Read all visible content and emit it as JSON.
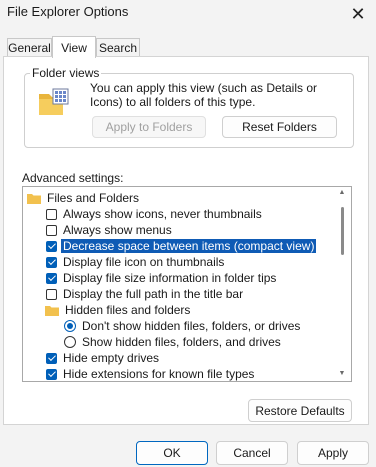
{
  "window": {
    "title": "File Explorer Options",
    "close_glyph": "✕"
  },
  "tabs": [
    {
      "label": "General",
      "active": false
    },
    {
      "label": "View",
      "active": true
    },
    {
      "label": "Search",
      "active": false
    }
  ],
  "folder_views": {
    "legend": "Folder views",
    "description": "You can apply this view (such as Details or Icons) to all folders of this type.",
    "apply_button": "Apply to Folders",
    "reset_button": "Reset Folders",
    "icon": "folder-grid-icon"
  },
  "advanced": {
    "label": "Advanced settings:",
    "items": [
      {
        "type": "folder",
        "label": "Files and Folders",
        "indent": 0
      },
      {
        "type": "checkbox",
        "label": "Always show icons, never thumbnails",
        "checked": false,
        "indent": 1
      },
      {
        "type": "checkbox",
        "label": "Always show menus",
        "checked": false,
        "indent": 1
      },
      {
        "type": "checkbox",
        "label": "Decrease space between items (compact view)",
        "checked": true,
        "indent": 1,
        "selected": true
      },
      {
        "type": "checkbox",
        "label": "Display file icon on thumbnails",
        "checked": true,
        "indent": 1
      },
      {
        "type": "checkbox",
        "label": "Display file size information in folder tips",
        "checked": true,
        "indent": 1
      },
      {
        "type": "checkbox",
        "label": "Display the full path in the title bar",
        "checked": false,
        "indent": 1
      },
      {
        "type": "folder",
        "label": "Hidden files and folders",
        "indent": 1
      },
      {
        "type": "radio",
        "label": "Don't show hidden files, folders, or drives",
        "checked": true,
        "indent": 2
      },
      {
        "type": "radio",
        "label": "Show hidden files, folders, and drives",
        "checked": false,
        "indent": 2
      },
      {
        "type": "checkbox",
        "label": "Hide empty drives",
        "checked": true,
        "indent": 1
      },
      {
        "type": "checkbox",
        "label": "Hide extensions for known file types",
        "checked": true,
        "indent": 1
      }
    ]
  },
  "restore_defaults": "Restore Defaults",
  "footer": {
    "ok": "OK",
    "cancel": "Cancel",
    "apply": "Apply"
  },
  "colors": {
    "accent": "#005fb8",
    "selection": "#0f5bb5",
    "folder": "#f2c14e"
  }
}
